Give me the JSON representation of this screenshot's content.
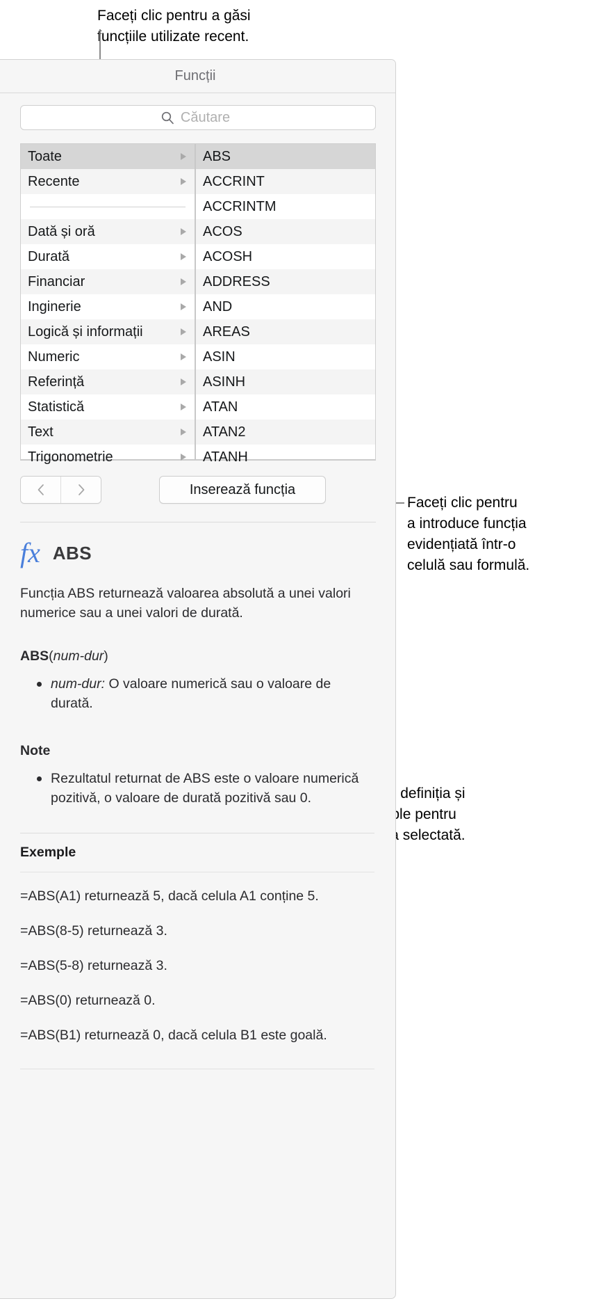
{
  "callouts": {
    "top": "Faceți clic pentru a găsi\nfuncțiile utilizate recent.",
    "insert": "Faceți clic pentru\na introduce funcția\nevidențiată într-o\ncelulă sau formulă.",
    "detail": "Vedeți definiția și\nexemple pentru\nfuncția selectată."
  },
  "panel": {
    "title": "Funcții"
  },
  "search": {
    "placeholder": "Căutare",
    "value": "",
    "icon": "search-icon"
  },
  "categories": [
    {
      "label": "Toate",
      "arrow": true,
      "selected": true
    },
    {
      "label": "Recente",
      "arrow": true,
      "selected": false
    },
    {
      "label": "",
      "arrow": false,
      "separator": true
    },
    {
      "label": "Dată și oră",
      "arrow": true,
      "selected": false
    },
    {
      "label": "Durată",
      "arrow": true,
      "selected": false
    },
    {
      "label": "Financiar",
      "arrow": true,
      "selected": false
    },
    {
      "label": "Inginerie",
      "arrow": true,
      "selected": false
    },
    {
      "label": "Logică și informații",
      "arrow": true,
      "selected": false
    },
    {
      "label": "Numeric",
      "arrow": true,
      "selected": false
    },
    {
      "label": "Referință",
      "arrow": true,
      "selected": false
    },
    {
      "label": "Statistică",
      "arrow": true,
      "selected": false
    },
    {
      "label": "Text",
      "arrow": true,
      "selected": false
    },
    {
      "label": "Trigonometrie",
      "arrow": true,
      "selected": false
    }
  ],
  "functions": [
    {
      "label": "ABS",
      "selected": true
    },
    {
      "label": "ACCRINT",
      "selected": false
    },
    {
      "label": "ACCRINTM",
      "selected": false
    },
    {
      "label": "ACOS",
      "selected": false
    },
    {
      "label": "ACOSH",
      "selected": false
    },
    {
      "label": "ADDRESS",
      "selected": false
    },
    {
      "label": "AND",
      "selected": false
    },
    {
      "label": "AREAS",
      "selected": false
    },
    {
      "label": "ASIN",
      "selected": false
    },
    {
      "label": "ASINH",
      "selected": false
    },
    {
      "label": "ATAN",
      "selected": false
    },
    {
      "label": "ATAN2",
      "selected": false
    },
    {
      "label": "ATANH",
      "selected": false
    }
  ],
  "buttons": {
    "prev_icon": "chevron-left-icon",
    "next_icon": "chevron-right-icon",
    "insert_label": "Inserează funcția"
  },
  "detail": {
    "fx_icon": "fx",
    "function_name": "ABS",
    "description": "Funcția ABS returnează valoarea absolută a unei valori numerice sau a unei valori de durată.",
    "syntax_name": "ABS",
    "syntax_args": "num-dur",
    "arguments": [
      {
        "name": "num-dur:",
        "text": " O valoare numerică sau o valoare de durată."
      }
    ],
    "notes_heading": "Note",
    "notes": [
      "Rezultatul returnat de ABS este o valoare numerică pozitivă, o valoare de durată pozitivă sau 0."
    ],
    "examples_heading": "Exemple",
    "examples": [
      "=ABS(A1) returnează 5, dacă celula A1 conține 5.",
      "=ABS(8-5) returnează 3.",
      "=ABS(5-8) returnează 3.",
      "=ABS(0) returnează 0.",
      "=ABS(B1) returnează 0, dacă celula B1 este goală."
    ]
  }
}
